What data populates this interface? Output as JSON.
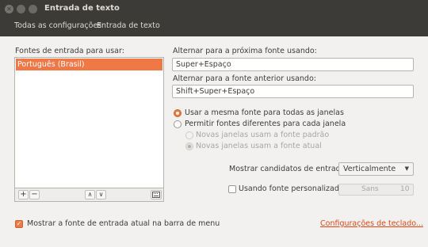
{
  "window": {
    "title": "Entrada de texto"
  },
  "toolbar": {
    "all_settings": "Todas as configurações",
    "current": "Entrada de texto"
  },
  "left": {
    "sources_label": "Fontes de entrada para usar:",
    "sources": [
      "Português (Brasil)"
    ],
    "add_glyph": "+",
    "remove_glyph": "−",
    "up_glyph": "∧",
    "down_glyph": "∨"
  },
  "right": {
    "next_label": "Alternar para a próxima fonte usando:",
    "next_value": "Super+Espaço",
    "prev_label": "Alternar para a fonte anterior usando:",
    "prev_value": "Shift+Super+Espaço",
    "radio_same": "Usar a mesma fonte para todas as janelas",
    "radio_different": "Permitir fontes diferentes para cada janela",
    "sub_default": "Novas janelas usam a fonte padrão",
    "sub_current": "Novas janelas usam a fonte atual",
    "candidates_label": "Mostrar candidatos de entrada:",
    "candidates_value": "Verticalmente",
    "custom_font_label": "Usando fonte personalizada:",
    "custom_font_name": "Sans",
    "custom_font_size": "10"
  },
  "footer": {
    "show_in_menu": "Mostrar a fonte de entrada atual na barra de menu",
    "keyboard_link": "Configurações de teclado..."
  },
  "colors": {
    "accent": "#f07746",
    "titlebar": "#3c3b37",
    "link": "#dd4814"
  },
  "icons": [
    "close-icon",
    "minimize-icon",
    "maximize-icon",
    "keyboard-icon",
    "dropdown-arrow-icon",
    "check-icon"
  ]
}
